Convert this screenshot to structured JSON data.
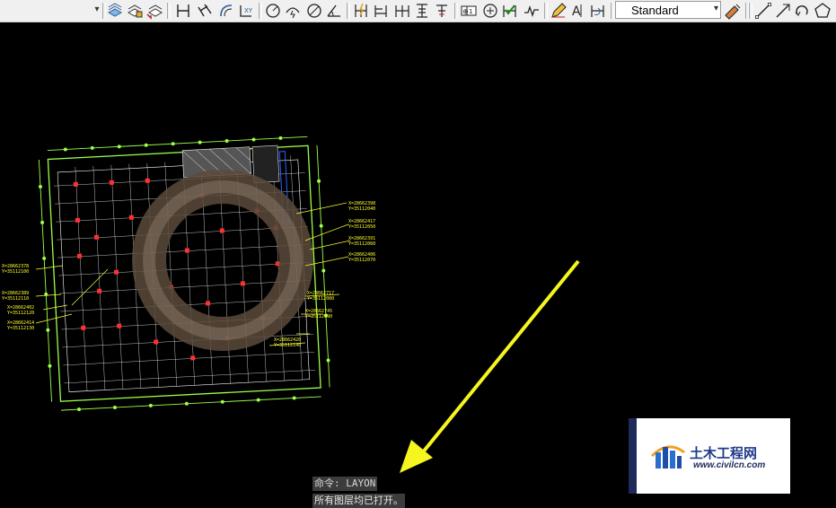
{
  "toolbar": {
    "text_style": "Standard",
    "tools": [
      {
        "icon": "layer-properties-icon"
      },
      {
        "icon": "layer-state-icon"
      },
      {
        "icon": "layer-previous-icon"
      },
      {
        "icon": "linear-dimension-icon"
      },
      {
        "icon": "aligned-dimension-icon"
      },
      {
        "icon": "arc-length-dimension-icon"
      },
      {
        "icon": "ordinate-dimension-icon"
      },
      {
        "icon": "radius-dimension-icon"
      },
      {
        "icon": "jogged-dimension-icon"
      },
      {
        "icon": "diameter-dimension-icon"
      },
      {
        "icon": "angular-dimension-icon"
      },
      {
        "icon": "quick-dimension-icon"
      },
      {
        "icon": "baseline-dimension-icon"
      },
      {
        "icon": "continue-dimension-icon"
      },
      {
        "icon": "dimension-space-icon"
      },
      {
        "icon": "dimension-break-icon"
      },
      {
        "icon": "tolerance-icon"
      },
      {
        "icon": "center-mark-icon"
      },
      {
        "icon": "inspection-icon"
      },
      {
        "icon": "jogged-linear-icon"
      },
      {
        "icon": "dimension-edit-icon"
      },
      {
        "icon": "dimension-text-edit-icon"
      },
      {
        "icon": "dimension-update-icon"
      },
      {
        "icon": "dimension-style-icon"
      },
      {
        "icon": "line-icon"
      },
      {
        "icon": "polyline-icon"
      },
      {
        "icon": "arc-icon"
      },
      {
        "icon": "polygon-icon"
      }
    ]
  },
  "command": {
    "prompt_line": "命令: LAYON",
    "result_line": "所有图层均已打开。"
  },
  "watermark": {
    "title": "土木工程网",
    "url": "www.civilcn.com"
  },
  "drawing": {
    "coordinate_labels": 14
  }
}
